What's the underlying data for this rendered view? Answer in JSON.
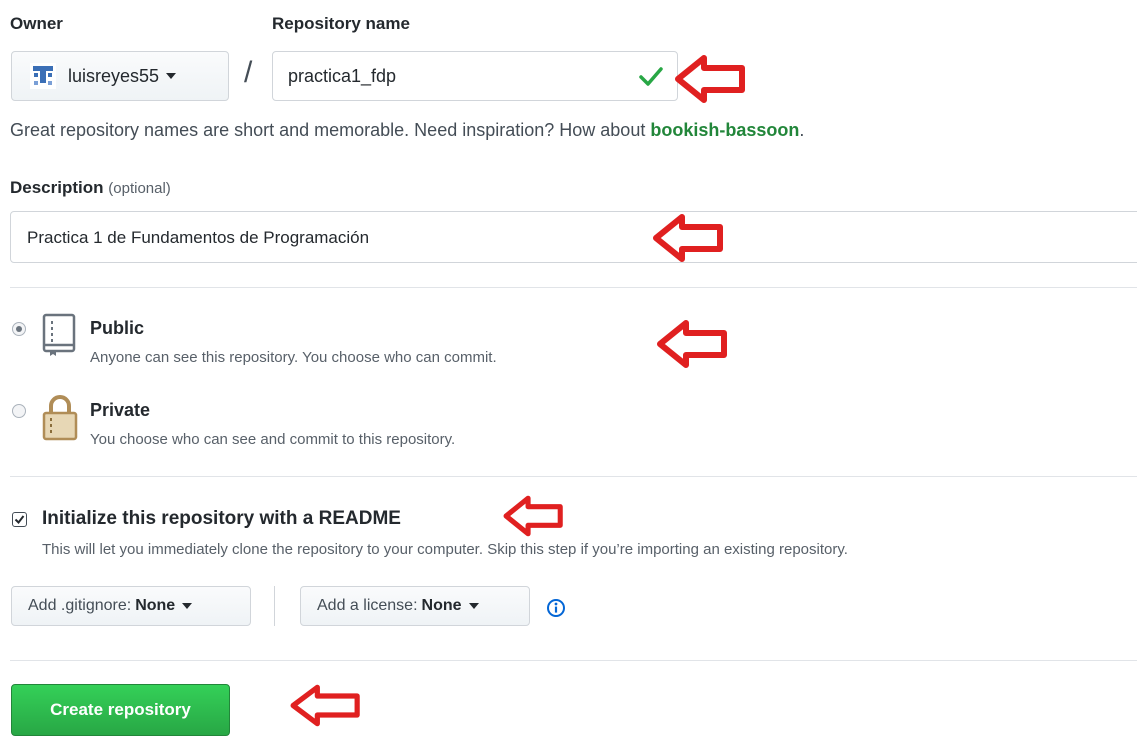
{
  "owner": {
    "label": "Owner",
    "selected": "luisreyes55"
  },
  "repository": {
    "label": "Repository name",
    "value": "practica1_fdp",
    "separator": "/"
  },
  "hint": {
    "text": "Great repository names are short and memorable. Need inspiration? How about ",
    "suggestion": "bookish-bassoon",
    "end": "."
  },
  "description": {
    "label": "Description",
    "optional": "(optional)",
    "value": "Practica 1 de Fundamentos de Programación"
  },
  "visibility": {
    "public": {
      "title": "Public",
      "desc": "Anyone can see this repository. You choose who can commit.",
      "checked": true
    },
    "private": {
      "title": "Private",
      "desc": "You choose who can see and commit to this repository.",
      "checked": false
    }
  },
  "readme": {
    "title": "Initialize this repository with a README",
    "desc": "This will let you immediately clone the repository to your computer. Skip this step if you’re importing an existing repository.",
    "checked": true
  },
  "gitignore": {
    "prefix": "Add .gitignore:",
    "value": "None"
  },
  "license": {
    "prefix": "Add a license:",
    "value": "None"
  },
  "submit": {
    "label": "Create repository"
  },
  "colors": {
    "primary_green": "#28a745",
    "arrow_red": "#e02020",
    "link_blue": "#0366d6"
  }
}
